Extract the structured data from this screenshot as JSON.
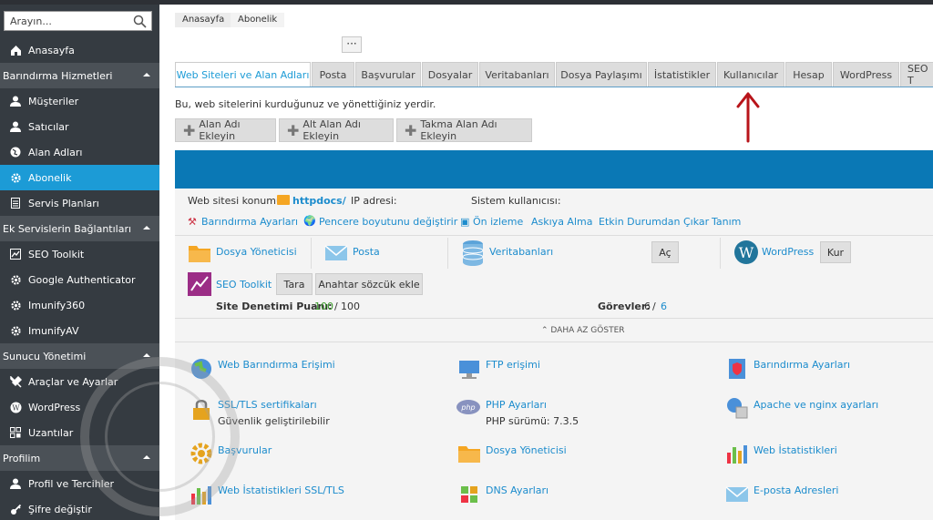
{
  "sidebar": {
    "search_placeholder": "Arayın...",
    "items": [
      {
        "label": "Anasayfa",
        "icon": "home-icon"
      },
      {
        "label": "Barındırma Hizmetleri",
        "header": true
      },
      {
        "label": "Müşteriler",
        "icon": "user-icon"
      },
      {
        "label": "Satıcılar",
        "icon": "user-icon"
      },
      {
        "label": "Alan Adları",
        "icon": "globe-icon"
      },
      {
        "label": "Abonelik",
        "icon": "gear-icon",
        "active": true
      },
      {
        "label": "Servis Planları",
        "icon": "document-icon"
      },
      {
        "label": "Ek Servislerin Bağlantıları",
        "header": true
      },
      {
        "label": "SEO Toolkit",
        "icon": "chart-icon"
      },
      {
        "label": "Google Authenticator",
        "icon": "gear-icon"
      },
      {
        "label": "Imunify360",
        "icon": "gear-icon"
      },
      {
        "label": "ImunifyAV",
        "icon": "gear-icon"
      },
      {
        "label": "Sunucu Yönetimi",
        "header": true
      },
      {
        "label": "Araçlar ve Ayarlar",
        "icon": "tools-icon"
      },
      {
        "label": "WordPress",
        "icon": "wordpress-icon"
      },
      {
        "label": "Uzantılar",
        "icon": "extensions-icon"
      },
      {
        "label": "Profilim",
        "header": true
      },
      {
        "label": "Profil ve Tercihler",
        "icon": "user-icon"
      },
      {
        "label": "Şifre değiştir",
        "icon": "key-icon"
      }
    ]
  },
  "breadcrumb": [
    "Anasayfa",
    "Abonelik"
  ],
  "more_button": "···",
  "tabs": [
    "Web Siteleri ve Alan Adları",
    "Posta",
    "Başvurular",
    "Dosyalar",
    "Veritabanları",
    "Dosya Paylaşımı",
    "İstatistikler",
    "Kullanıcılar",
    "Hesap",
    "WordPress",
    "SEO T"
  ],
  "description": "Bu, web sitelerini kurduğunuz ve yönettiğiniz yerdir.",
  "actions": [
    "Alan Adı Ekleyin",
    "Alt Alan Adı Ekleyin",
    "Takma Alan Adı Ekleyin"
  ],
  "site": {
    "location_label": "Web sitesi konumu",
    "location_value": "httpdocs/",
    "ip_label": "IP adresi:",
    "sysuser_label": "Sistem kullanıcısı:",
    "links": [
      "Barındırma Ayarları",
      "Pencere boyutunu değiştirir",
      "Ön izleme",
      "Askıya Alma",
      "Etkin Durumdan Çıkar",
      "Tanım"
    ]
  },
  "quick": {
    "file_manager": "Dosya Yöneticisi",
    "mail": "Posta",
    "databases": "Veritabanları",
    "open_btn": "Aç",
    "wordpress": "WordPress",
    "install_btn": "Kur",
    "seo": "SEO Toolkit",
    "scan_btn": "Tara",
    "keyword_btn": "Anahtar sözcük ekle",
    "score_label": "Site Denetimi Puanı:",
    "score_value": "100",
    "score_sep": "/",
    "score_max": "100",
    "tasks_label": "Görevler:",
    "tasks_value": "6",
    "tasks_sep": "/",
    "tasks_max": "6",
    "less": "DAHA AZ GÖSTER"
  },
  "tools": [
    {
      "label": "Web Barındırma Erişimi",
      "icon": "globe-icon"
    },
    {
      "label": "FTP erişimi",
      "icon": "ftp-icon"
    },
    {
      "label": "Barındırma Ayarları",
      "icon": "server-icon"
    },
    {
      "label": "SSL/TLS sertifikaları",
      "icon": "lock-icon",
      "sub": "Güvenlik geliştirilebilir"
    },
    {
      "label": "PHP Ayarları",
      "icon": "php-icon",
      "sub": "PHP sürümü: 7.3.5"
    },
    {
      "label": "Apache ve nginx ayarları",
      "icon": "apache-icon"
    },
    {
      "label": "Başvurular",
      "icon": "gear-icon"
    },
    {
      "label": "Dosya Yöneticisi",
      "icon": "folder-icon"
    },
    {
      "label": "Web İstatistikleri",
      "icon": "stats-icon"
    },
    {
      "label": "Web İstatistikleri SSL/TLS",
      "icon": "stats-icon"
    },
    {
      "label": "DNS Ayarları",
      "icon": "dns-icon"
    },
    {
      "label": "E-posta Adresleri",
      "icon": "mail-icon"
    }
  ],
  "colors": {
    "accent": "#1c9bd6",
    "sidebar": "#353b41",
    "band": "#0a78b5",
    "arrow": "#b8141a"
  }
}
